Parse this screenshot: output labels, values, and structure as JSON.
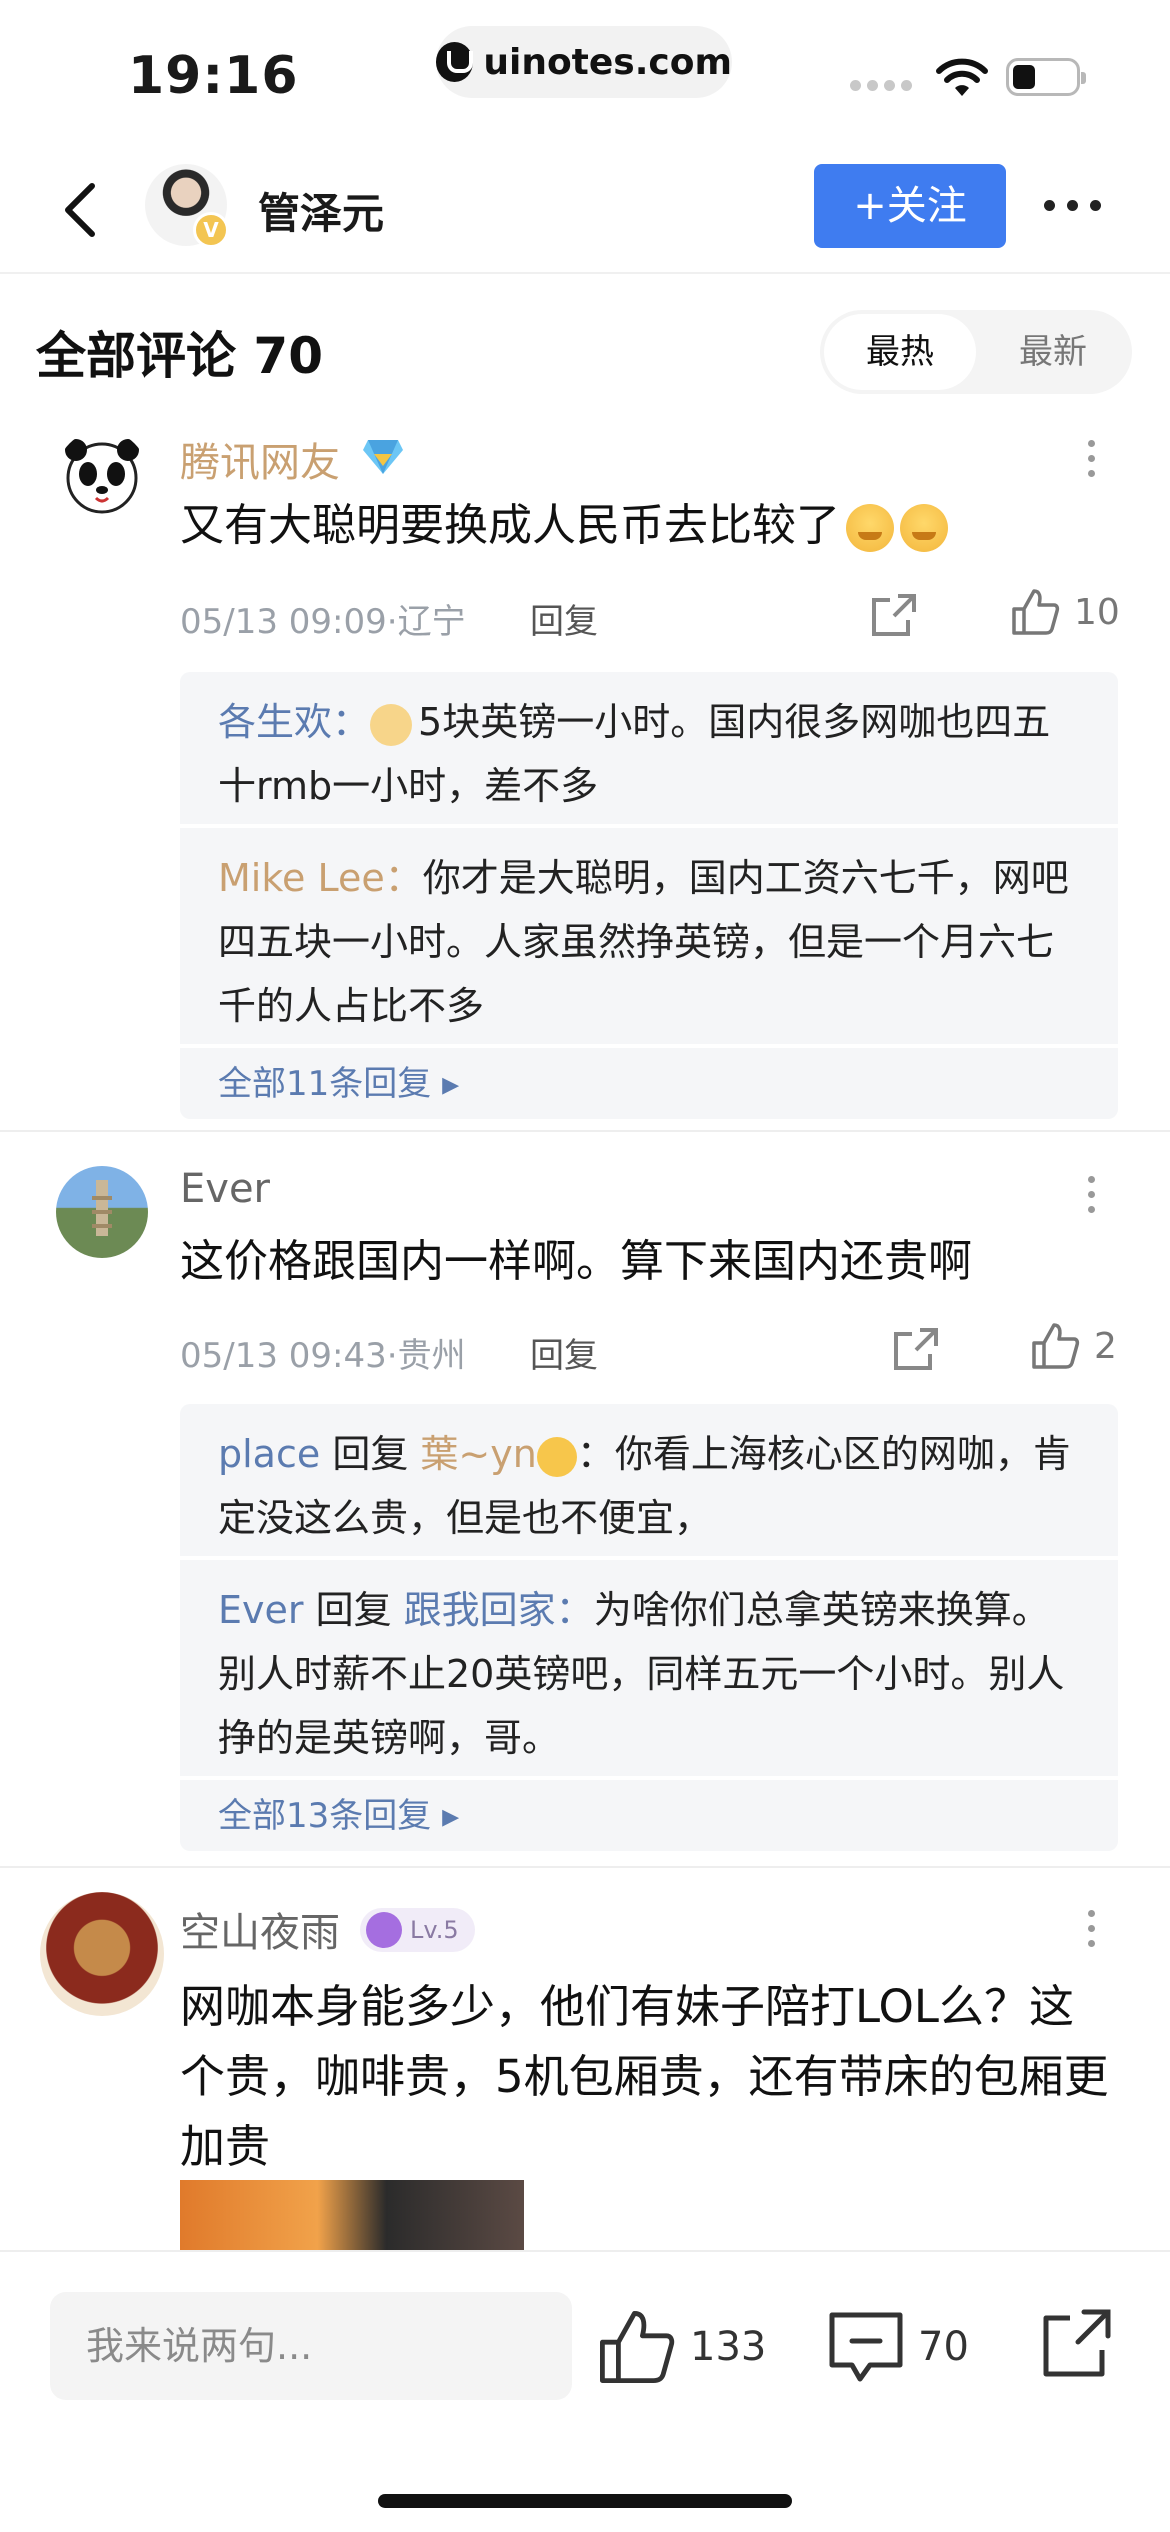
{
  "status_bar": {
    "time": "19:16",
    "url": "uinotes.com"
  },
  "nav": {
    "name": "管泽元",
    "follow_label": "+关注"
  },
  "comments_header": {
    "title": "全部评论 70",
    "sort_hot": "最热",
    "sort_new": "最新"
  },
  "comments": [
    {
      "name": "腾讯网友",
      "text": "又有大聪明要换成人民币去比较了",
      "meta": "05/13 09:09·辽宁",
      "reply_label": "回复",
      "likes": "10",
      "replies": [
        {
          "user": "各生欢：",
          "text": "5块英镑一小时。国内很多网咖也四五十rmb一小时，差不多"
        },
        {
          "user": "Mike Lee：",
          "text": "你才是大聪明，国内工资六七千，网吧四五块一小时。人家虽然挣英镑，但是一个月六七千的人占比不多"
        }
      ],
      "more_replies": "全部11条回复 ▸"
    },
    {
      "name": "Ever",
      "text": "这价格跟国内一样啊。算下来国内还贵啊",
      "meta": "05/13 09:43·贵州",
      "reply_label": "回复",
      "likes": "2",
      "replies": [
        {
          "user": "place",
          "mid": " 回复 ",
          "target": "葉~yn",
          "colon": "：",
          "text": "你看上海核心区的网咖，肯定没这么贵，但是也不便宜，"
        },
        {
          "user": "Ever",
          "mid": " 回复 ",
          "target": "跟我回家：",
          "colon": "",
          "text": "为啥你们总拿英镑来换算。别人时薪不止20英镑吧，同样五元一个小时。别人挣的是英镑啊，哥。"
        }
      ],
      "more_replies": "全部13条回复 ▸"
    },
    {
      "name": "空山夜雨",
      "level": "Lv.5",
      "text": "网咖本身能多少，他们有妹子陪打LOL么？这个贵，咖啡贵，5机包厢贵，还有带床的包厢更加贵"
    }
  ],
  "bottom_bar": {
    "input_placeholder": "我来说两句...",
    "likes": "133",
    "comments": "70"
  },
  "colors": {
    "accent": "#3f7cf0",
    "username_tan": "#c9a071",
    "reply_blue": "#5b7bb0"
  }
}
